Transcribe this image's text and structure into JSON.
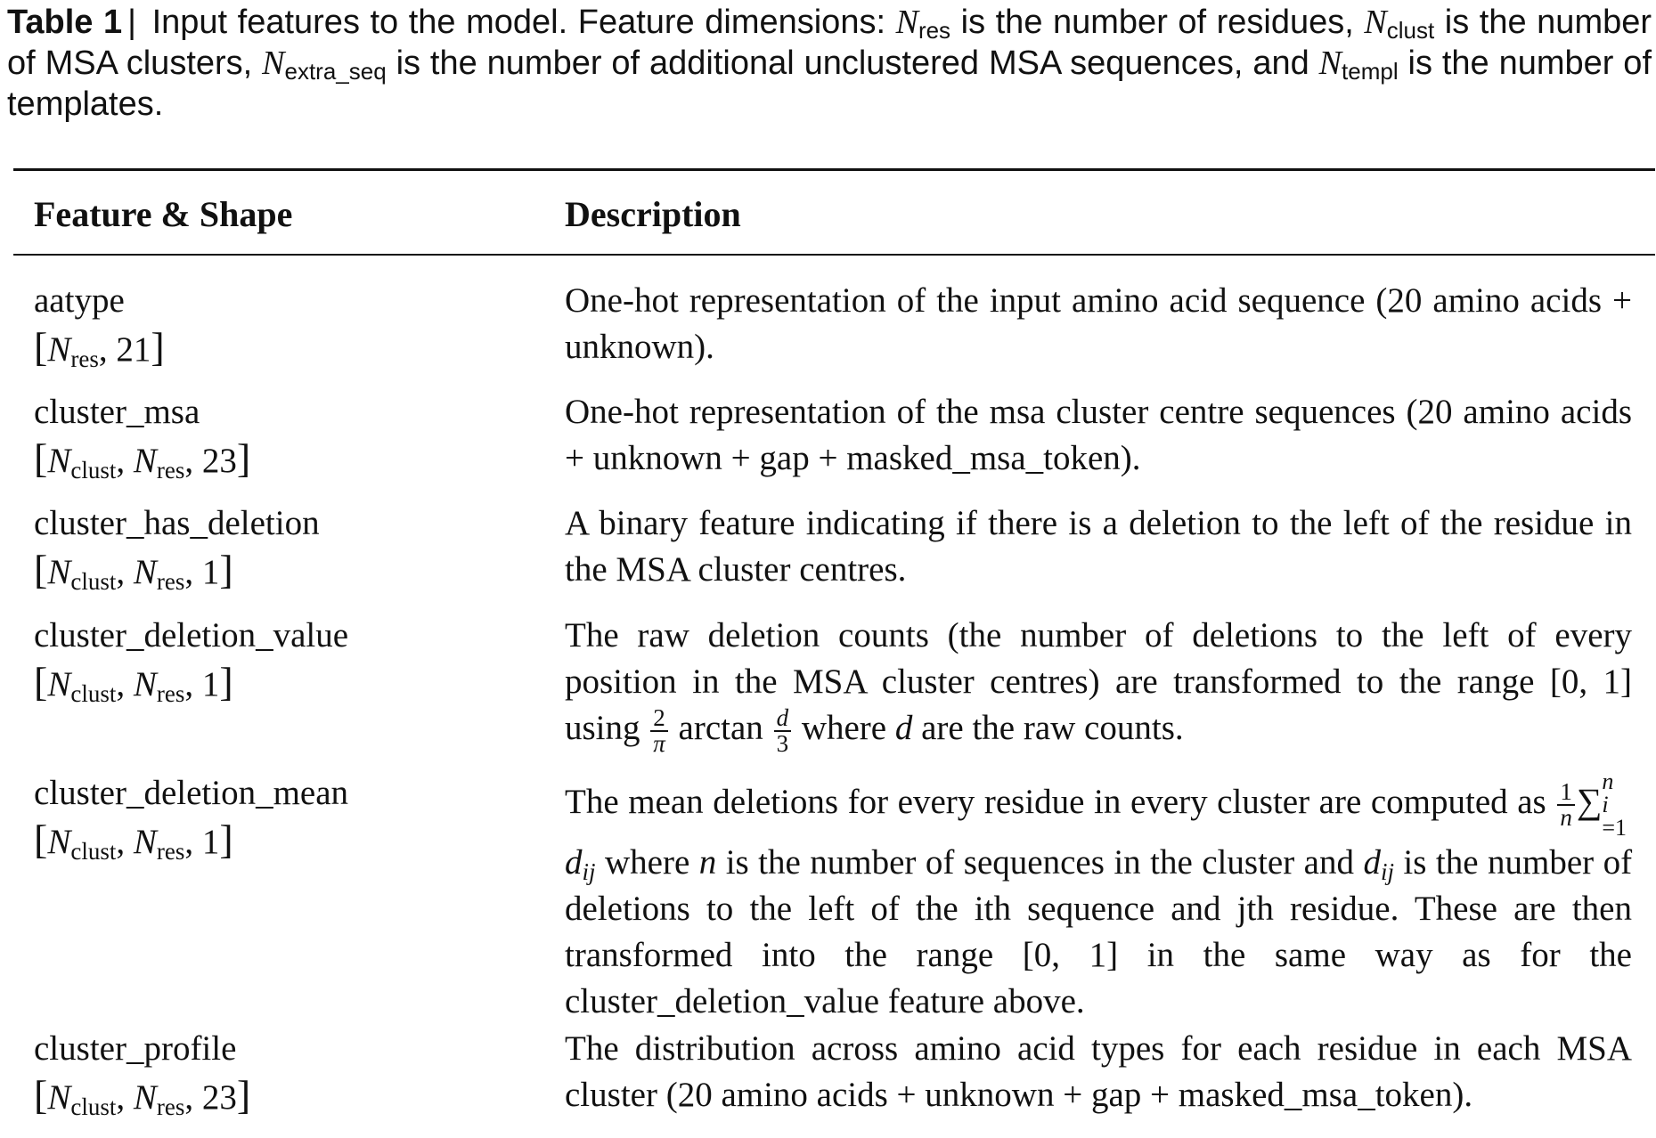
{
  "caption": {
    "label": "Table 1",
    "separator": "|",
    "text_1": "Input features to the model.  Feature dimensions:",
    "n_res_sub": "res",
    "text_2": "is the number of residues,",
    "n_clust_sub": "clust",
    "text_3": "is the number of MSA clusters,",
    "n_extra_sub": "extra_seq",
    "text_4": "is the number of additional unclustered MSA sequences, and",
    "n_templ_sub": "templ",
    "text_5": "is the number of templates."
  },
  "table": {
    "headers": [
      "Feature & Shape",
      "Description"
    ],
    "rows": [
      {
        "feature": "aatype",
        "shape_dims": "21",
        "description": "One-hot representation of the input amino acid sequence (20 amino acids + unknown)."
      },
      {
        "feature": "cluster_msa",
        "shape_dims": "23",
        "description": "One-hot representation of the msa cluster centre sequences (20 amino acids + unknown + gap + masked_msa_token)."
      },
      {
        "feature": "cluster_has_deletion",
        "shape_dims": "1",
        "description": "A binary feature indicating if there is a deletion to the left of the residue in the MSA cluster centres."
      },
      {
        "feature": "cluster_deletion_value",
        "shape_dims": "1",
        "description_1": "The raw deletion counts (the number of deletions to the left of every position in the MSA cluster centres) are transformed to the range [0, 1] using",
        "description_2": "arctan",
        "description_3": "where",
        "description_4": "are the raw counts."
      },
      {
        "feature": "cluster_deletion_mean",
        "shape_dims": "1",
        "description_1": "The mean deletions for every residue in every cluster are computed as",
        "description_2": "where",
        "description_3": "is the number of sequences in the cluster and",
        "description_4": "is the number of deletions to the left of the ith sequence and jth residue. These are then transformed into the range [0, 1] in the same way as for the cluster_deletion_value feature above."
      },
      {
        "feature": "cluster_profile",
        "shape_dims": "23",
        "description": "The distribution across amino acid types for each residue in each MSA cluster (20 amino acids + unknown + gap + masked_msa_token)."
      }
    ]
  }
}
